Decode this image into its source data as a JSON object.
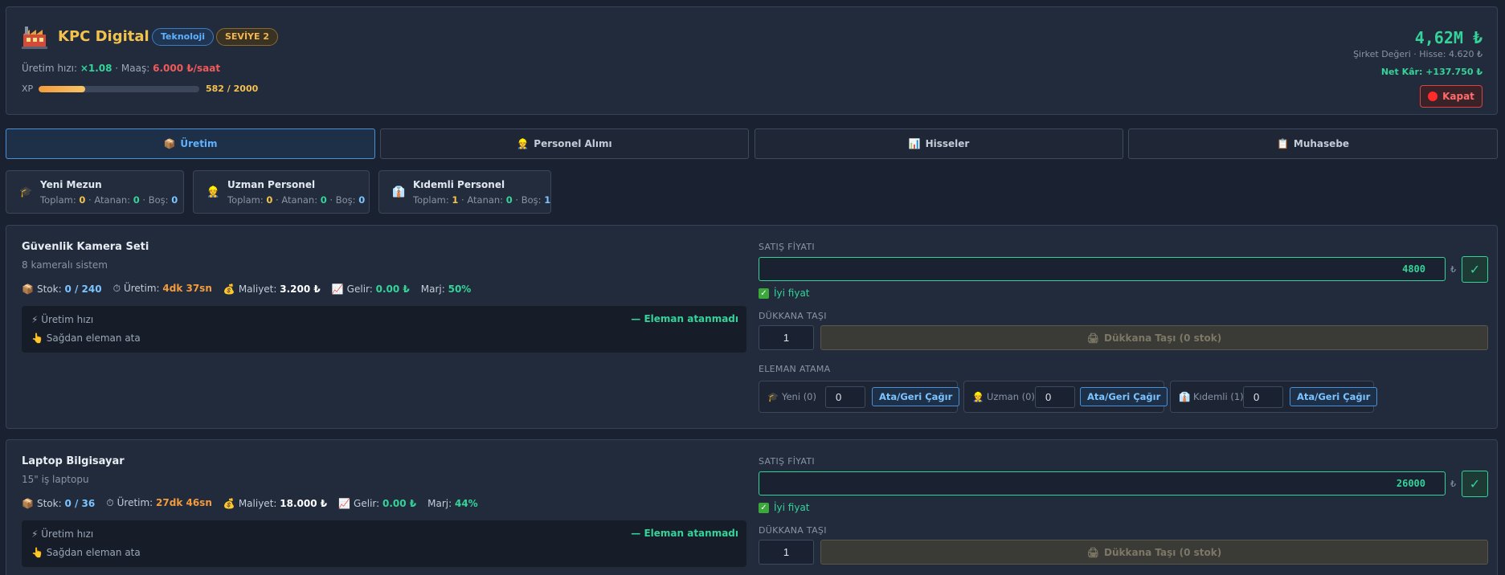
{
  "header": {
    "company_name": "KPC Digital",
    "sector_badge": "Teknoloji",
    "level_badge": "SEVİYE 2",
    "production_speed_label": "Üretim hızı: ",
    "production_speed_value": "×1.08",
    "salary_label": " · Maaş: ",
    "salary_value": "6.000 ₺/saat",
    "xp_label": "XP",
    "xp_text": "582 / 2000",
    "xp_progress": 0.291,
    "company_value": "4,62M ₺",
    "company_value_sub": "Şirket Değeri · Hisse: 4.620 ₺",
    "net_profit": "Net Kâr: +137.750 ₺",
    "close_label": "Kapat"
  },
  "tabs": [
    {
      "icon": "📦",
      "label": "Üretim",
      "active": true
    },
    {
      "icon": "👷",
      "label": "Personel Alımı",
      "active": false
    },
    {
      "icon": "📊",
      "label": "Hisseler",
      "active": false
    },
    {
      "icon": "📋",
      "label": "Muhasebe",
      "active": false
    }
  ],
  "personnel": [
    {
      "icon": "🎓",
      "name": "Yeni Mezun",
      "total": "0",
      "assigned": "0",
      "free": "0"
    },
    {
      "icon": "👷",
      "name": "Uzman Personel",
      "total": "0",
      "assigned": "0",
      "free": "0"
    },
    {
      "icon": "👔",
      "name": "Kıdemli Personel",
      "total": "1",
      "assigned": "0",
      "free": "1"
    }
  ],
  "personnel_labels": {
    "total": "Toplam: ",
    "assigned": " · Atanan: ",
    "free": " · Boş: "
  },
  "product_labels": {
    "stock": "Stok: ",
    "production": "Üretim: ",
    "cost": "Maliyet: ",
    "revenue": "Gelir: ",
    "margin": "Marj: ",
    "speed": "Üretim hızı",
    "assign_hint": "Sağdan eleman ata",
    "no_staff": "— Eleman atanmadı",
    "sale_price": "SATIŞ FİYATI",
    "currency": "₺",
    "confirm": "✓",
    "good_price": "İyi fiyat",
    "move_to_shop": "DÜKKANA TAŞI",
    "move_button": "Dükkana Taşı (0 stok)",
    "staff_assign": "ELEMAN ATAMA",
    "assign_new": "Yeni (0)",
    "assign_expert": "Uzman (0)",
    "assign_senior": "Kıdemli (1)",
    "assign_button": "Ata/Geri Çağır"
  },
  "products": [
    {
      "name": "Güvenlik Kamera Seti",
      "description": "8 kameralı sistem",
      "stock": "0 / 240",
      "production_time": "4dk 37sn",
      "cost": "3.200 ₺",
      "revenue": "0.00 ₺",
      "margin": "50%",
      "price": "4800",
      "move_qty": "1",
      "assign_new_value": "0",
      "assign_expert_value": "0",
      "assign_senior_value": "0"
    },
    {
      "name": "Laptop Bilgisayar",
      "description": "15\" iş laptopu",
      "stock": "0 / 36",
      "production_time": "27dk 46sn",
      "cost": "18.000 ₺",
      "revenue": "0.00 ₺",
      "margin": "44%",
      "price": "26000",
      "move_qty": "1"
    }
  ]
}
